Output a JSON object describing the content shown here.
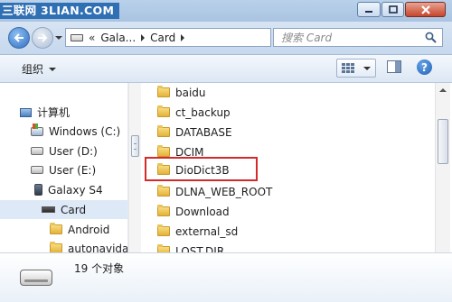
{
  "watermark": "三联网 3LIAN.COM",
  "address": {
    "overflow": "«",
    "segments": [
      "Gala...",
      "Card"
    ]
  },
  "search": {
    "placeholder": "搜索 Card"
  },
  "toolbar": {
    "organize_label": "组织"
  },
  "nav": {
    "items": [
      {
        "label": "计算机",
        "icon": "computer-icon"
      },
      {
        "label": "Windows (C:)",
        "icon": "windows-drive-icon"
      },
      {
        "label": "User (D:)",
        "icon": "drive-icon"
      },
      {
        "label": "User (E:)",
        "icon": "drive-icon"
      },
      {
        "label": "Galaxy S4",
        "icon": "phone-icon"
      },
      {
        "label": "Card",
        "icon": "card-icon",
        "selected": true
      },
      {
        "label": "Android",
        "icon": "folder-icon"
      },
      {
        "label": "autonavidat",
        "icon": "folder-icon"
      }
    ]
  },
  "files": {
    "items": [
      "baidu",
      "ct_backup",
      "DATABASE",
      "DCIM",
      "DioDict3B",
      "DLNA_WEB_ROOT",
      "Download",
      "external_sd",
      "LOST.DIR"
    ],
    "highlighted": "DioDict3B"
  },
  "details": {
    "count_text": "19 个对象"
  },
  "colors": {
    "highlight_border": "#d42a2a",
    "selected_bg": "#dde9f7",
    "folder": "#e4b23a"
  }
}
